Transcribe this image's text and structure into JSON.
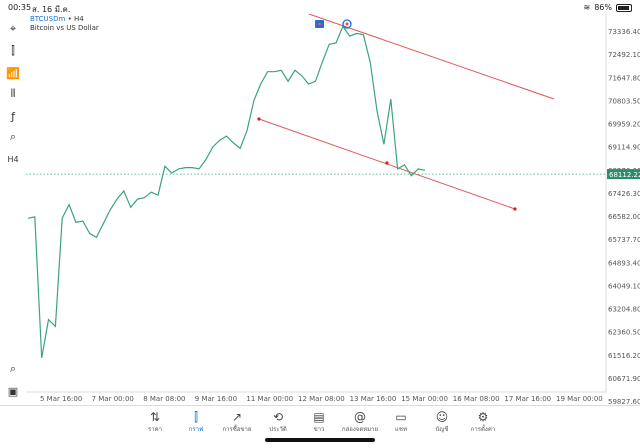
{
  "status_bar": {
    "time": "00:35",
    "date": "ส. 16 มี.ค.",
    "wifi": "wifi-icon",
    "battery": "86%"
  },
  "symbol": {
    "name": "BTCUSDm",
    "sep": " • ",
    "timeframe": "H4",
    "description": "Bitcoin vs US Dollar"
  },
  "toolbar": [
    {
      "name": "crosshair-icon",
      "glyph": "⌖"
    },
    {
      "name": "candles-icon",
      "glyph": "⫿"
    },
    {
      "name": "indicators-icon",
      "glyph": "📶"
    },
    {
      "name": "lines-icon",
      "glyph": "⫴"
    },
    {
      "name": "function-icon",
      "glyph": "ƒ"
    },
    {
      "name": "objects-icon",
      "glyph": "⌕"
    },
    {
      "name": "timeframe-label",
      "glyph": "H4"
    }
  ],
  "chart_data": {
    "type": "line",
    "symbol": "BTCUSDm",
    "current_price": "68112.22",
    "price_ticks": [
      "73336.40",
      "72492.10",
      "71647.80",
      "70803.50",
      "69959.20",
      "69114.90",
      "68270.60",
      "67426.30",
      "66582.00",
      "65737.70",
      "64893.40",
      "64049.10",
      "63204.80",
      "62360.50",
      "61516.20",
      "60671.90",
      "59827.60"
    ],
    "time_ticks": [
      "5 Mar 16:00",
      "7 Mar 00:00",
      "8 Mar 08:00",
      "9 Mar 16:00",
      "11 Mar 00:00",
      "12 Mar 08:00",
      "13 Mar 16:00",
      "15 Mar 00:00",
      "16 Mar 08:00",
      "17 Mar 16:00",
      "19 Mar 00:00"
    ],
    "series": [
      {
        "color": "#3aa57a",
        "values": [
          66500,
          66550,
          61400,
          62800,
          62550,
          66500,
          67000,
          66350,
          66400,
          65950,
          65800,
          66300,
          66800,
          67200,
          67500,
          66900,
          67200,
          67250,
          67450,
          67350,
          68400,
          68150,
          68300,
          68350,
          68350,
          68300,
          68650,
          69100,
          69350,
          69500,
          69250,
          69050,
          69700,
          70800,
          71400,
          71850,
          71850,
          71900,
          71500,
          71900,
          71700,
          71400,
          71500,
          72200,
          72850,
          72900,
          73500,
          73150,
          73250,
          73200,
          72200,
          70400,
          69200,
          70850,
          68300,
          68450,
          68050,
          68300,
          68250
        ]
      }
    ],
    "grid": false,
    "price_line": 68112.22
  },
  "bottom_nav": [
    {
      "name": "tab-quotes",
      "icon": "⇅",
      "label": "ราคา",
      "active": false
    },
    {
      "name": "tab-chart",
      "icon": "⫿",
      "label": "กราฟ",
      "active": true
    },
    {
      "name": "tab-trade",
      "icon": "↗",
      "label": "การซื้อขาย",
      "active": false
    },
    {
      "name": "tab-history",
      "icon": "⟲",
      "label": "ประวัติ",
      "active": false
    },
    {
      "name": "tab-news",
      "icon": "▤",
      "label": "ข่าว",
      "active": false
    },
    {
      "name": "tab-mailbox",
      "icon": "@",
      "label": "กล่องจดหมาย",
      "active": false
    },
    {
      "name": "tab-chat",
      "icon": "▭",
      "label": "แชท",
      "active": false
    },
    {
      "name": "tab-accounts",
      "icon": "☺",
      "label": "บัญชี",
      "active": false
    },
    {
      "name": "tab-settings",
      "icon": "⚙",
      "label": "การตั้งค่า",
      "active": false
    }
  ]
}
